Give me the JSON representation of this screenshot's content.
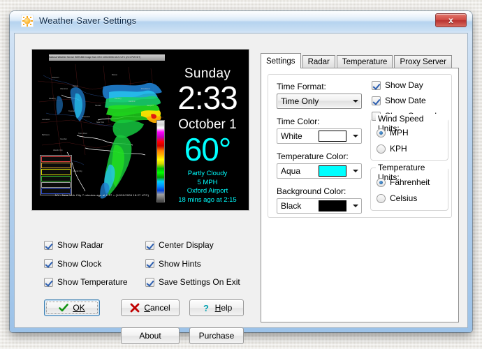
{
  "window": {
    "title": "Weather Saver Settings",
    "icon": "sun-icon",
    "close_label": "x"
  },
  "preview": {
    "day": "Sunday",
    "time": "2:33",
    "date": "October 1",
    "temperature": "60°",
    "condition": "Partly Cloudy",
    "wind": "5 MPH",
    "station": "Oxford Airport",
    "updated": "18 mins ago at 2:15",
    "time_color": "#FFFFFF",
    "temp_color": "#00FFFF",
    "background_color": "#000000",
    "radar": {
      "header": "National Weather Service WSR-88D Image from OKX 10/01/2006 18:21 UTC (2:21 PM EDT)",
      "caption": "NY - New York City    7 minutes ago at 2:27   =    (10/01/2006 18:27 UTC)",
      "legend_items": [
        "Interstate",
        "US Route",
        "State Hwy",
        "County",
        "State Border",
        "Region"
      ]
    }
  },
  "options": {
    "rows": [
      [
        {
          "label": "Show Radar",
          "checked": true,
          "name": "show-radar"
        },
        {
          "label": "Center Display",
          "checked": true,
          "name": "center-display"
        }
      ],
      [
        {
          "label": "Show Clock",
          "checked": true,
          "name": "show-clock"
        },
        {
          "label": "Show Hints",
          "checked": true,
          "name": "show-hints"
        }
      ],
      [
        {
          "label": "Show Temperature",
          "checked": true,
          "name": "show-temperature"
        },
        {
          "label": "Save Settings On Exit",
          "checked": true,
          "name": "save-settings-on-exit"
        }
      ]
    ]
  },
  "buttons": {
    "ok": "OK",
    "cancel": "Cancel",
    "help": "Help",
    "about": "About",
    "purchase": "Purchase"
  },
  "tabs": [
    {
      "label": "Settings",
      "active": true
    },
    {
      "label": "Radar",
      "active": false
    },
    {
      "label": "Temperature",
      "active": false
    },
    {
      "label": "Proxy Server",
      "active": false
    }
  ],
  "settings": {
    "time_format": {
      "label": "Time Format:",
      "value": "Time Only"
    },
    "time_color": {
      "label": "Time Color:",
      "value": "White",
      "swatch": "#FFFFFF"
    },
    "temperature_color": {
      "label": "Temperature Color:",
      "value": "Aqua",
      "swatch": "#00FFFF"
    },
    "background_color": {
      "label": "Background Color:",
      "value": "Black",
      "swatch": "#000000"
    },
    "show_day": {
      "label": "Show Day",
      "checked": true
    },
    "show_date": {
      "label": "Show Date",
      "checked": true
    },
    "show_seconds": {
      "label": "Show Seconds",
      "checked": false
    },
    "wind_speed_units": {
      "title": "Wind Speed Units:",
      "options": [
        {
          "label": "MPH",
          "selected": true
        },
        {
          "label": "KPH",
          "selected": false
        }
      ]
    },
    "temperature_units": {
      "title": "Temperature Units:",
      "options": [
        {
          "label": "Fahrenheit",
          "selected": true
        },
        {
          "label": "Celsius",
          "selected": false
        }
      ]
    }
  }
}
